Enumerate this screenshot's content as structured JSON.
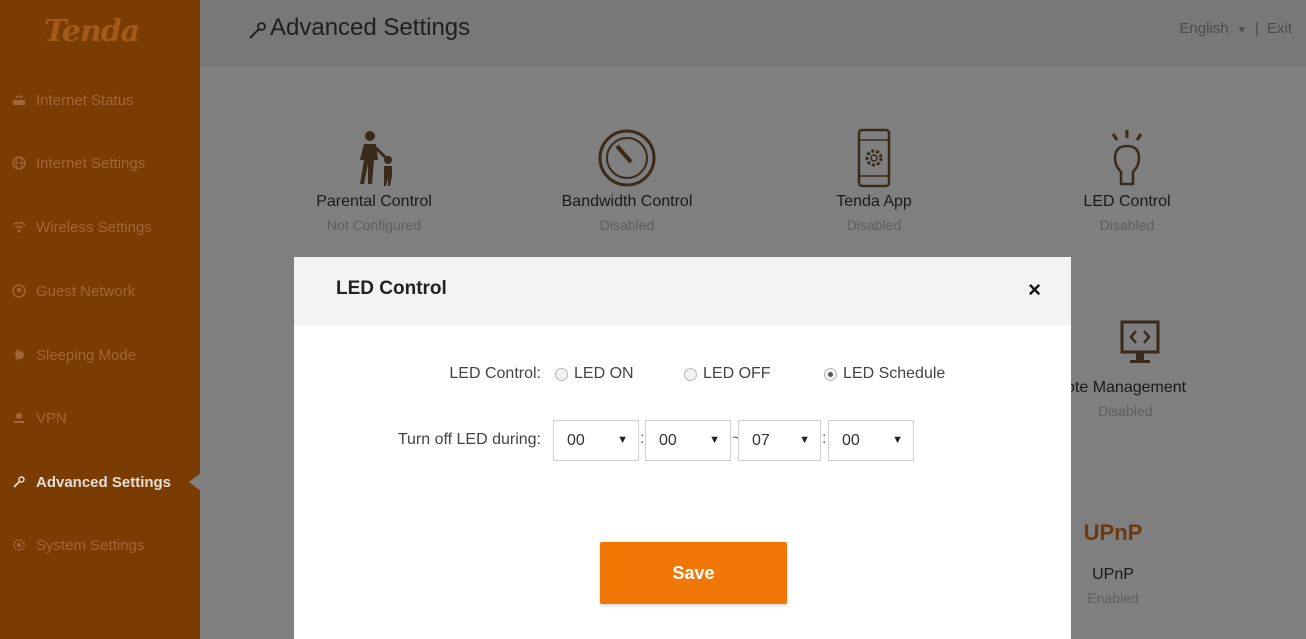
{
  "brand": {
    "logo": "Tenda"
  },
  "sidebar": {
    "items": [
      {
        "label": "Internet Status",
        "icon": "router-icon"
      },
      {
        "label": "Internet Settings",
        "icon": "globe-icon"
      },
      {
        "label": "Wireless Settings",
        "icon": "wifi-icon"
      },
      {
        "label": "Guest Network",
        "icon": "guest-icon"
      },
      {
        "label": "Sleeping Mode",
        "icon": "moon-icon"
      },
      {
        "label": "VPN",
        "icon": "vpn-icon"
      },
      {
        "label": "Advanced Settings",
        "icon": "wrench-icon",
        "active": true
      },
      {
        "label": "System Settings",
        "icon": "gear-icon"
      }
    ]
  },
  "header": {
    "title": "Advanced Settings",
    "language": "English",
    "exit": "Exit",
    "separator": "|"
  },
  "tiles": [
    {
      "name": "Parental Control",
      "status": "Not Configured",
      "icon": "parent-child-icon"
    },
    {
      "name": "Bandwidth Control",
      "status": "Disabled",
      "icon": "speedometer-icon"
    },
    {
      "name": "Tenda App",
      "status": "Disabled",
      "icon": "tablet-gear-icon"
    },
    {
      "name": "LED Control",
      "status": "Disabled",
      "icon": "light-bulb-icon"
    },
    {
      "name": "ote Management",
      "status": "Disabled",
      "icon": "monitor-code-icon"
    },
    {
      "name": "UPnP",
      "status": "Enabled",
      "icon": "upnp-icon",
      "icon_text": "UPnP"
    }
  ],
  "modal": {
    "title": "LED Control",
    "close": "×",
    "led_label": "LED Control:",
    "options": [
      "LED ON",
      "LED OFF",
      "LED Schedule"
    ],
    "selected": "LED Schedule",
    "turn_off_label": "Turn off LED during:",
    "start_hour": "00",
    "start_min": "00",
    "end_hour": "07",
    "end_min": "00",
    "time_sep": ":",
    "range_sep": "~",
    "save": "Save"
  },
  "colors": {
    "sidebar_bg": "#7a3c02",
    "accent": "#f07706",
    "overlay": "#7f7f7f"
  }
}
